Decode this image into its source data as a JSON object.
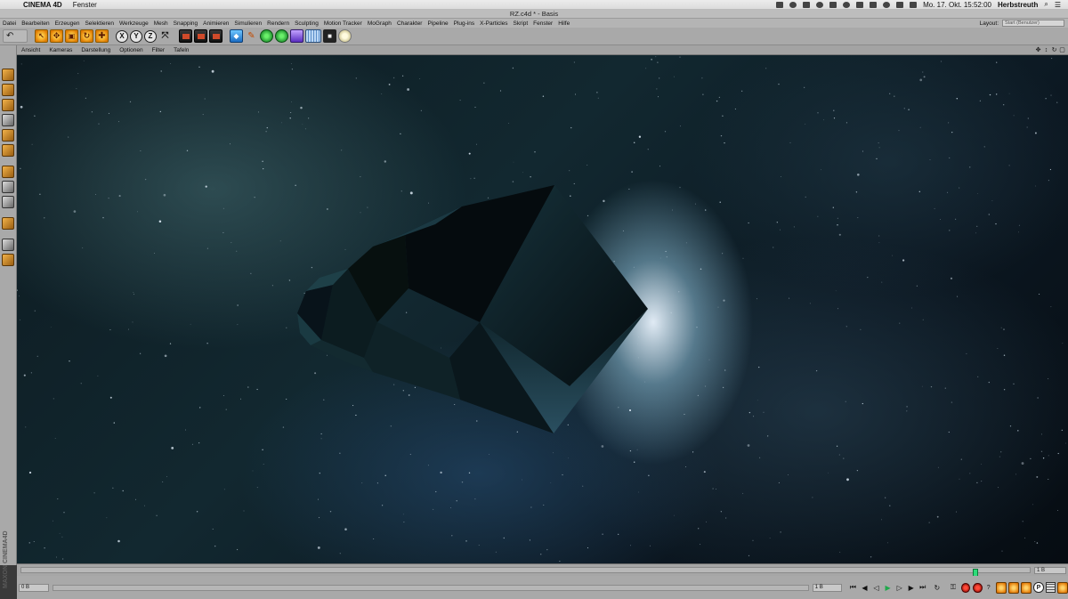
{
  "mac_menubar": {
    "app_name": "CINEMA 4D",
    "menu": "Fenster",
    "clock": "Mo. 17. Okt.  15:52:00",
    "user": "Herbstreuth"
  },
  "window": {
    "title": "RZ.c4d * - Basis"
  },
  "app_menu": {
    "items": [
      "Datei",
      "Bearbeiten",
      "Erzeugen",
      "Selektieren",
      "Werkzeuge",
      "Mesh",
      "Snapping",
      "Animieren",
      "Simulieren",
      "Rendern",
      "Sculpting",
      "Motion Tracker",
      "MoGraph",
      "Charakter",
      "Pipeline",
      "Plug-ins",
      "X-Particles",
      "Skript",
      "Fenster",
      "Hilfe"
    ],
    "layout_label": "Layout:",
    "layout_value": "Start (Benutzer)"
  },
  "toolbar": {
    "axis_x": "X",
    "axis_y": "Y",
    "axis_z": "Z"
  },
  "viewport_menu": {
    "items": [
      "Ansicht",
      "Kameras",
      "Darstellung",
      "Optionen",
      "Filter",
      "Tafeln"
    ]
  },
  "timeline": {
    "marker_fraction": 0.95,
    "end_frame": "1 B"
  },
  "transport": {
    "start_field": "0 B",
    "end_field": "1 B"
  },
  "palette_logo": "MAXON CINEMA4D",
  "colors": {
    "accent_green": "#2ddc7a",
    "record_red": "#ff4a3a",
    "tool_orange": "#e07b00"
  }
}
